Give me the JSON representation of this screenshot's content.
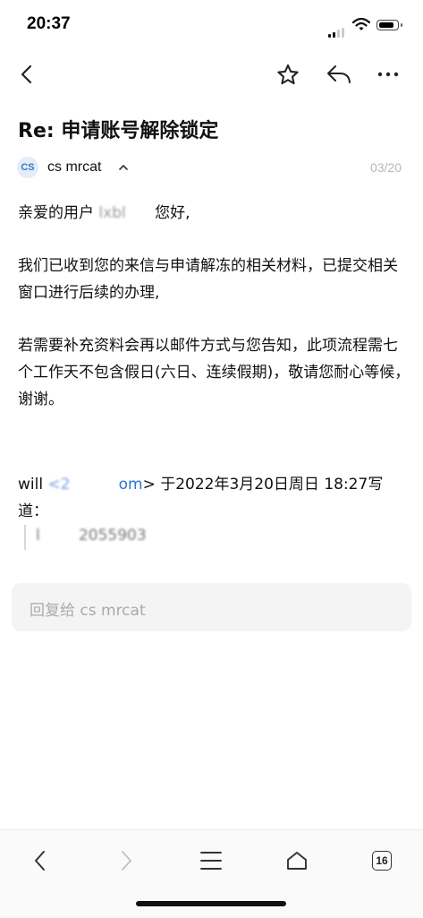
{
  "status_bar": {
    "time": "20:37"
  },
  "email": {
    "subject": "Re: 申请账号解除锁定",
    "avatar_initials": "CS",
    "sender": "cs mrcat",
    "date": "03/20",
    "greeting_prefix": "亲爱的用户",
    "greeting_redacted": "lxbl     ",
    "greeting_suffix": "您好,",
    "paragraph_2": "我们已收到您的来信与申请解冻的相关材料，已提交相关窗口进行后续的办理,",
    "paragraph_3": "若需要补充资料会再以邮件方式与您告知，此项流程需七个工作天不包含假日(六日、连续假期)，敬请您耐心等候，谢谢。",
    "quote_from_name": "will",
    "quote_email_redacted": "<2          ",
    "quote_email_tail": "om",
    "quote_suffix": "> 于2022年3月20日周日 18:27写道：",
    "quoted_text_redacted": "l        ",
    "quoted_text_tail": "2055903"
  },
  "reply": {
    "placeholder": "回复给 cs mrcat"
  },
  "toolbar": {
    "tab_count": "16"
  }
}
